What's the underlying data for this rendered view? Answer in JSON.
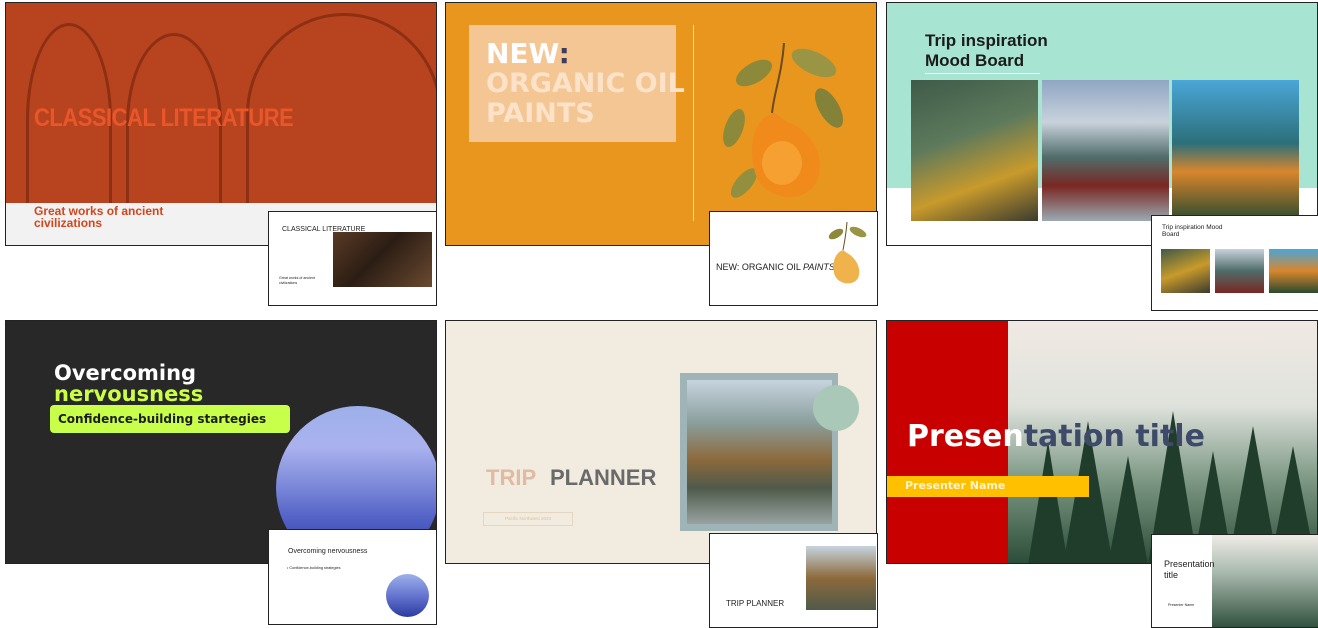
{
  "templates": [
    {
      "title": "CLASSICAL LITERATURE",
      "subtitle": "Great works of ancient civilizations",
      "thumb_title": "CLASSICAL LITERATURE",
      "thumb_subtitle": "Great works of ancient civilizations"
    },
    {
      "title_prefix": "NEW",
      "title_colon": ":",
      "title_rest": "ORGANIC OIL PAINTS",
      "thumb_title": "NEW: ORGANIC OIL ",
      "thumb_title_italic": "PAINTS"
    },
    {
      "title": "Trip inspiration Mood Board",
      "thumb_title": "Trip inspiration Mood Board"
    },
    {
      "title_line1": "Overcoming",
      "title_line2": "nervousness",
      "subtitle": "Confidence-building startegies",
      "thumb_title": "Overcoming nervousness",
      "thumb_bullet": "• Confidence-building  strategies"
    },
    {
      "title_word1": "TRIP",
      "title_word2": "PLANNER",
      "subtitle": "Pacific Northwest 2023",
      "thumb_title": "TRIP PLANNER"
    },
    {
      "title_part1": "Presen",
      "title_part2": "tation title",
      "presenter": "Presenter Name",
      "thumb_title": "Presentation title",
      "thumb_presenter": "Presenter Name"
    }
  ],
  "colors": {
    "classical_bg": "#b8431f",
    "organic_bg": "#e8961e",
    "trip_bg": "#a8e4d2",
    "nervous_bg": "#282828",
    "nervous_accent": "#c7ff4a",
    "planner_bg": "#f1ebe0",
    "presentation_red": "#c90000",
    "presentation_yellow": "#ffc000"
  }
}
